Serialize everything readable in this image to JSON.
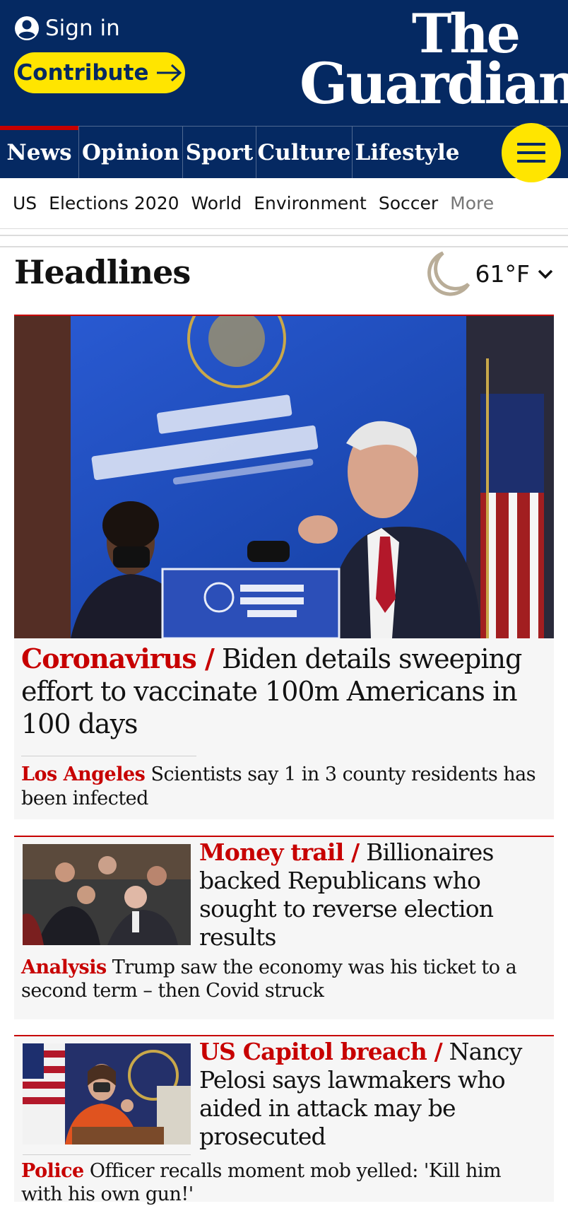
{
  "header": {
    "sign_in": "Sign in",
    "contribute": "Contribute",
    "logo_line1": "The",
    "logo_line2": "Guardian"
  },
  "pillars": [
    "News",
    "Opinion",
    "Sport",
    "Culture",
    "Lifestyle"
  ],
  "subnav": [
    "US",
    "Elections 2020",
    "World",
    "Environment",
    "Soccer",
    "More"
  ],
  "section": {
    "title": "Headlines",
    "weather_temp": "61°F",
    "weather_icon": "moon-icon"
  },
  "lead": {
    "kicker": "Coronavirus /",
    "headline": "Biden details sweeping effort to vaccinate 100m Americans in 100 days",
    "sub_kicker": "Los Angeles",
    "sub_text": "Scientists say 1 in 3 county residents has been infected"
  },
  "cards": [
    {
      "kicker": "Money trail /",
      "headline": "Billionaires backed Republicans who sought to reverse election results",
      "sub_kicker": "Analysis",
      "sub_text": "Trump saw the economy was his ticket to a second term – then Covid struck"
    },
    {
      "kicker": "US Capitol breach /",
      "headline": "Nancy Pelosi says lawmakers who aided in attack may be prosecuted",
      "sub_kicker": "Police",
      "sub_text": "Officer recalls moment mob yelled: 'Kill him with his own gun!'"
    }
  ],
  "colors": {
    "brand_blue": "#052962",
    "news_red": "#c70000",
    "contribute_yellow": "#ffe500"
  }
}
